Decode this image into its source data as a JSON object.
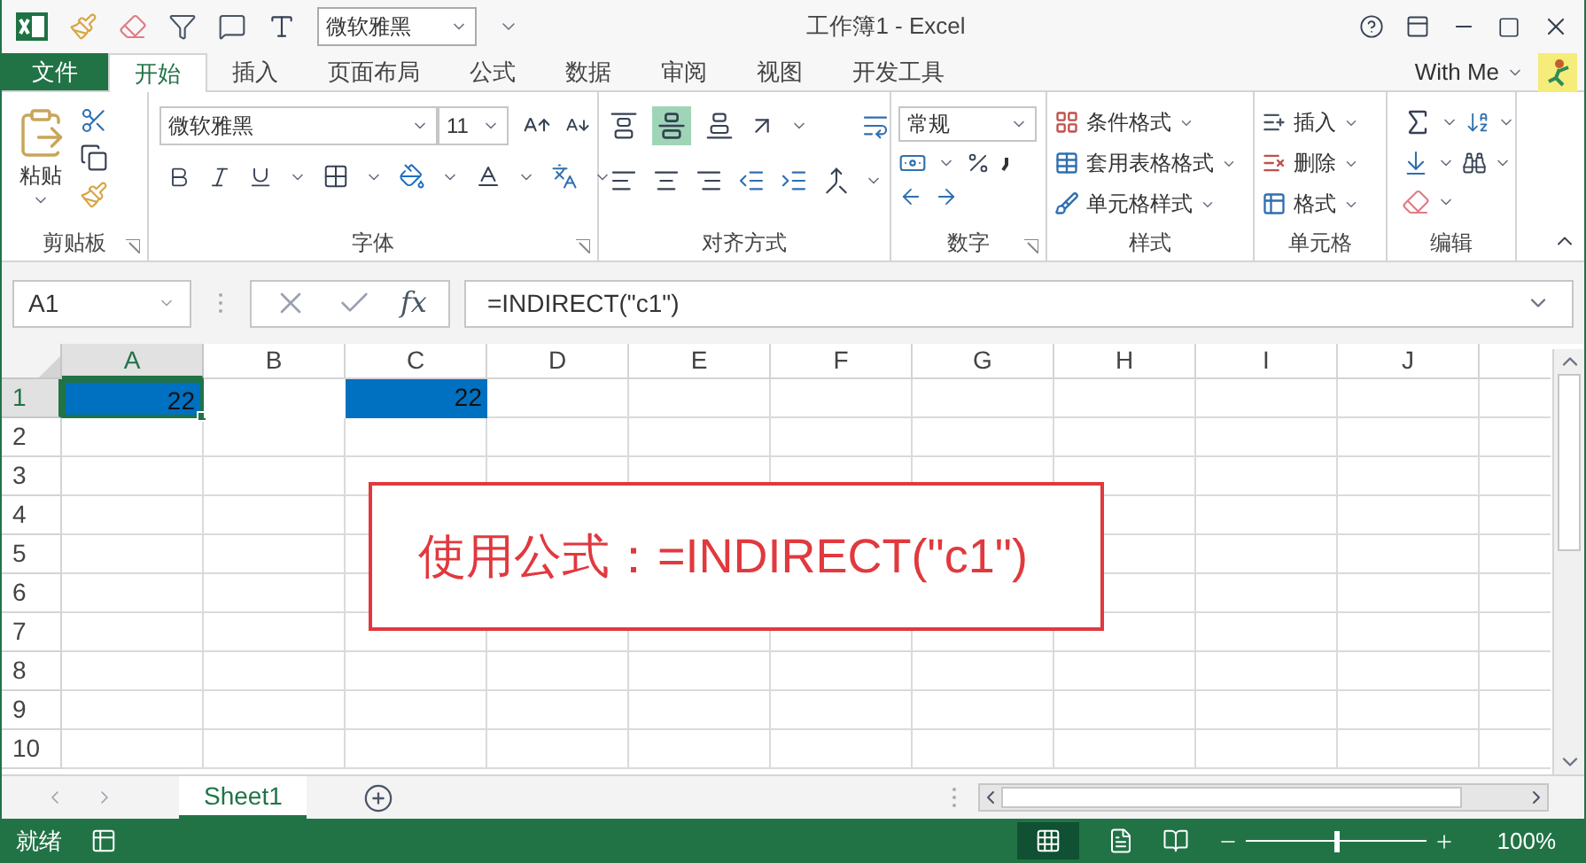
{
  "quick_access": {
    "font_box": "微软雅黑"
  },
  "window": {
    "title": "工作簿1 - Excel",
    "account": "With Me"
  },
  "tabs": [
    {
      "label": "文件",
      "kind": "file",
      "selected": false
    },
    {
      "label": "开始",
      "kind": "tab",
      "selected": true
    },
    {
      "label": "插入",
      "kind": "tab",
      "selected": false
    },
    {
      "label": "页面布局",
      "kind": "tab",
      "selected": false
    },
    {
      "label": "公式",
      "kind": "tab",
      "selected": false
    },
    {
      "label": "数据",
      "kind": "tab",
      "selected": false
    },
    {
      "label": "审阅",
      "kind": "tab",
      "selected": false
    },
    {
      "label": "视图",
      "kind": "tab",
      "selected": false
    },
    {
      "label": "开发工具",
      "kind": "tab",
      "selected": false
    }
  ],
  "ribbon": {
    "clipboard": {
      "paste": "粘贴",
      "label": "剪贴板"
    },
    "font": {
      "name": "微软雅黑",
      "size": "11",
      "label": "字体"
    },
    "alignment": {
      "label": "对齐方式"
    },
    "number": {
      "format": "常规",
      "label": "数字"
    },
    "styles": {
      "items": [
        "条件格式",
        "套用表格格式",
        "单元格样式"
      ],
      "label": "样式"
    },
    "cells": {
      "items": [
        "插入",
        "删除",
        "格式"
      ],
      "label": "单元格"
    },
    "editing": {
      "label": "编辑"
    }
  },
  "formula_bar": {
    "name_box": "A1",
    "function_label": "fx",
    "formula": "=INDIRECT(\"c1\")"
  },
  "grid": {
    "columns": [
      {
        "label": "A",
        "selected": true
      },
      {
        "label": "B",
        "selected": false
      },
      {
        "label": "C",
        "selected": false
      },
      {
        "label": "D",
        "selected": false
      },
      {
        "label": "E",
        "selected": false
      },
      {
        "label": "F",
        "selected": false
      },
      {
        "label": "G",
        "selected": false
      },
      {
        "label": "H",
        "selected": false
      },
      {
        "label": "I",
        "selected": false
      },
      {
        "label": "J",
        "selected": false
      }
    ],
    "rows": [
      {
        "header": "1",
        "selected": true,
        "cells": [
          {
            "value": "22",
            "highlighted": true,
            "selected": true
          },
          {
            "highlighted": false,
            "selected": false
          },
          {
            "value": "22",
            "highlighted": true,
            "selected": false
          }
        ]
      },
      {
        "header": "2",
        "selected": false
      },
      {
        "header": "3",
        "selected": false
      },
      {
        "header": "4",
        "selected": false
      },
      {
        "header": "5",
        "selected": false
      },
      {
        "header": "6",
        "selected": false
      },
      {
        "header": "7",
        "selected": false
      },
      {
        "header": "8",
        "selected": false
      },
      {
        "header": "9",
        "selected": false
      },
      {
        "header": "10",
        "selected": false
      }
    ]
  },
  "annotation": {
    "text": "使用公式：=INDIRECT(\"c1\")"
  },
  "sheets": [
    {
      "label": "Sheet1",
      "selected": true
    }
  ],
  "status_bar": {
    "status": "就绪",
    "zoom": "100%",
    "zoom_slider": {
      "level": 0.5
    }
  }
}
